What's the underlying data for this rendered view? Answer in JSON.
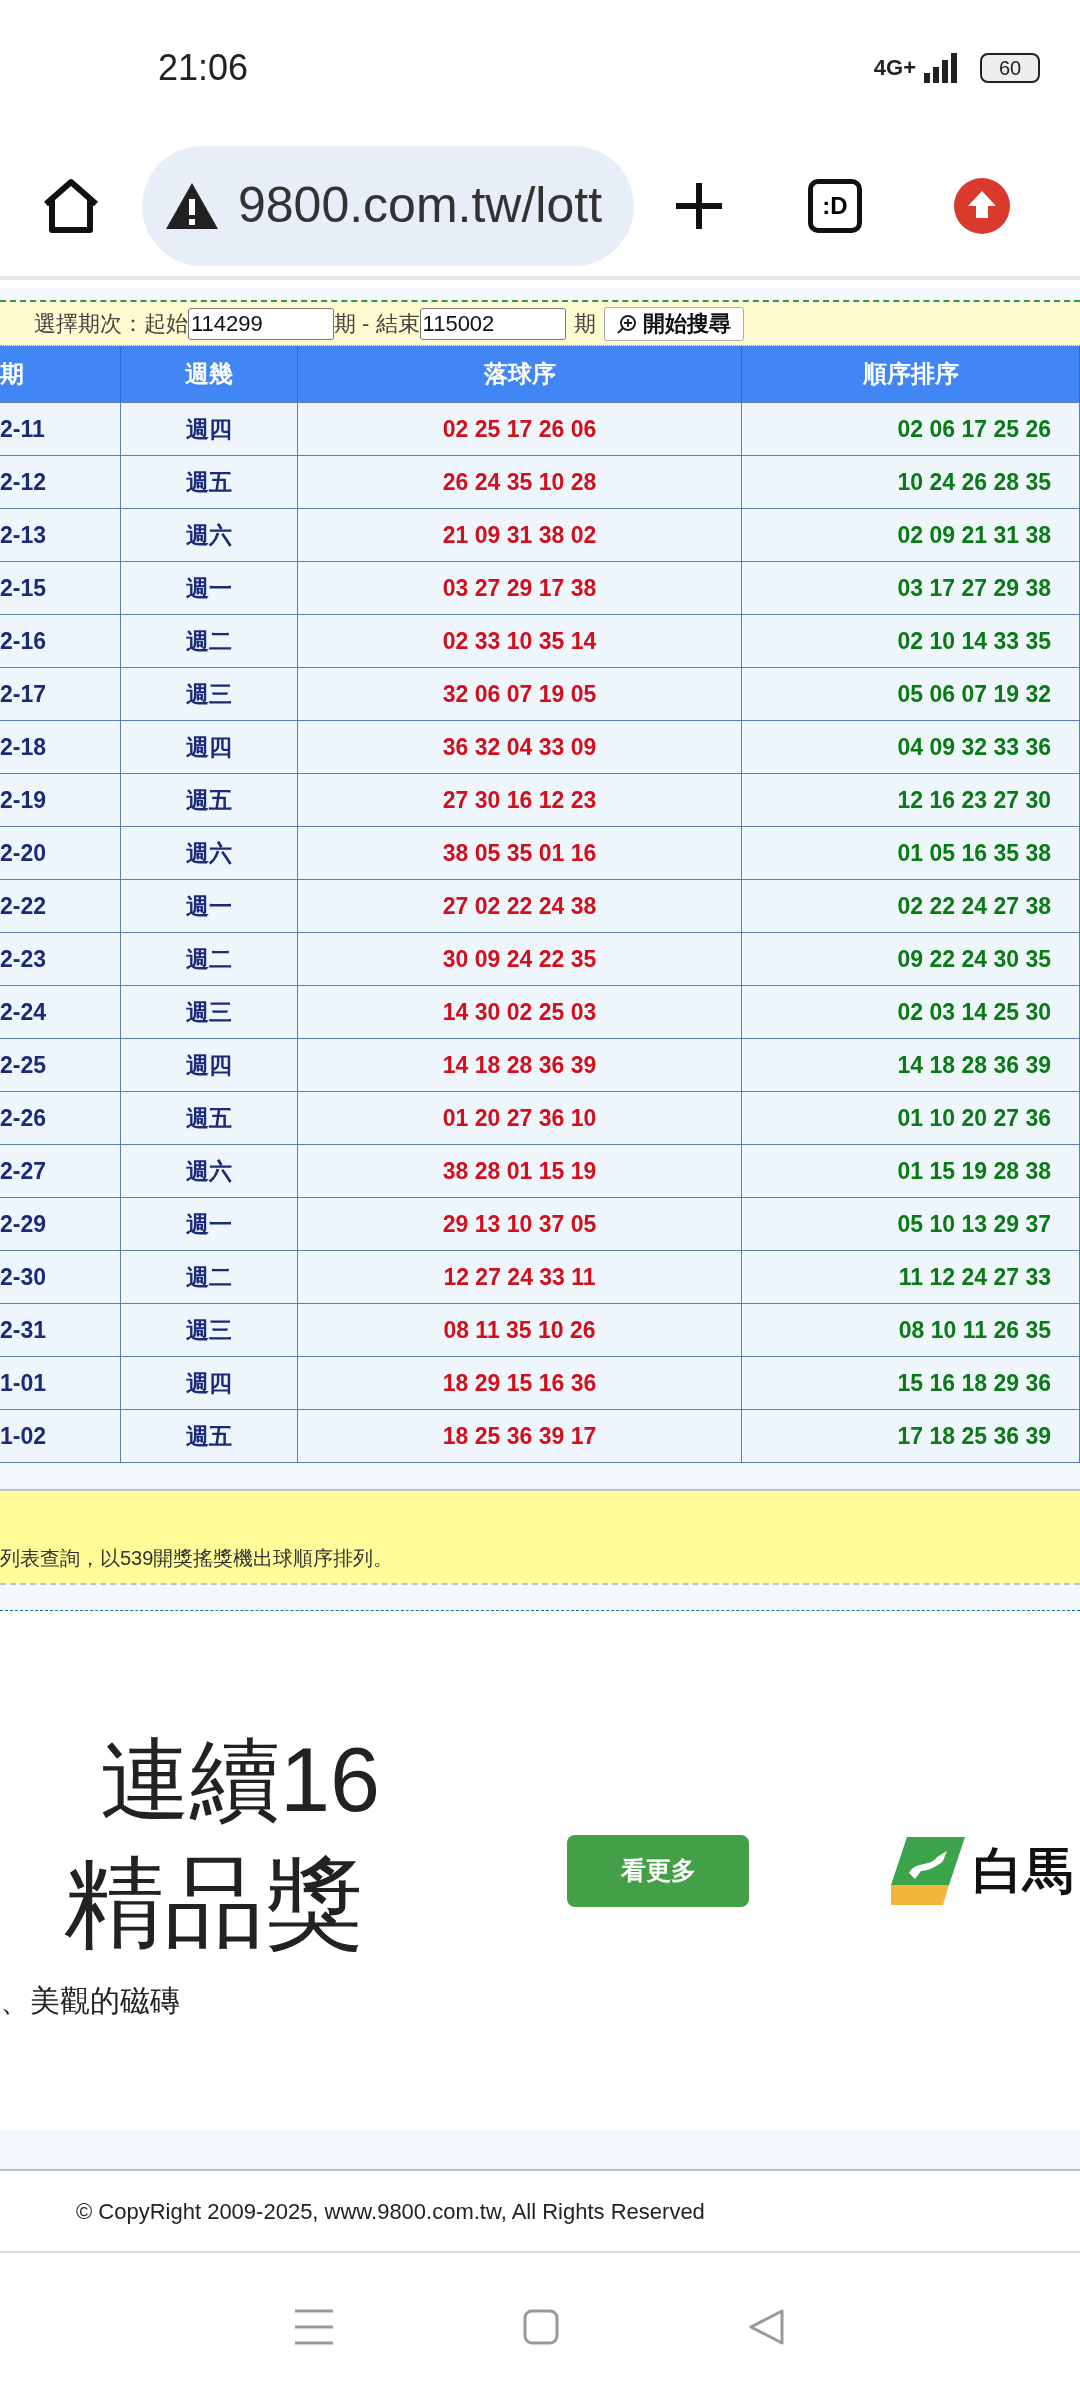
{
  "status_bar": {
    "time": "21:06",
    "network": "4G+",
    "battery": "60"
  },
  "browser": {
    "url": "9800.com.tw/lott",
    "tab_button": ":D"
  },
  "search": {
    "label": "選擇期次：起始",
    "start": "114299",
    "mid": "期 - 結束",
    "end": "115002",
    "suffix": "期",
    "button": "開始搜尋"
  },
  "table": {
    "columns": [
      "期",
      "週幾",
      "落球序",
      "順序排序"
    ],
    "rows": [
      [
        "2-11",
        "週四",
        "02 25 17 26 06",
        "02 06 17 25 26"
      ],
      [
        "2-12",
        "週五",
        "26 24 35 10 28",
        "10 24 26 28 35"
      ],
      [
        "2-13",
        "週六",
        "21 09 31 38 02",
        "02 09 21 31 38"
      ],
      [
        "2-15",
        "週一",
        "03 27 29 17 38",
        "03 17 27 29 38"
      ],
      [
        "2-16",
        "週二",
        "02 33 10 35 14",
        "02 10 14 33 35"
      ],
      [
        "2-17",
        "週三",
        "32 06 07 19 05",
        "05 06 07 19 32"
      ],
      [
        "2-18",
        "週四",
        "36 32 04 33 09",
        "04 09 32 33 36"
      ],
      [
        "2-19",
        "週五",
        "27 30 16 12 23",
        "12 16 23 27 30"
      ],
      [
        "2-20",
        "週六",
        "38 05 35 01 16",
        "01 05 16 35 38"
      ],
      [
        "2-22",
        "週一",
        "27 02 22 24 38",
        "02 22 24 27 38"
      ],
      [
        "2-23",
        "週二",
        "30 09 24 22 35",
        "09 22 24 30 35"
      ],
      [
        "2-24",
        "週三",
        "14 30 02 25 03",
        "02 03 14 25 30"
      ],
      [
        "2-25",
        "週四",
        "14 18 28 36 39",
        "14 18 28 36 39"
      ],
      [
        "2-26",
        "週五",
        "01 20 27 36 10",
        "01 10 20 27 36"
      ],
      [
        "2-27",
        "週六",
        "38 28 01 15 19",
        "01 15 19 28 38"
      ],
      [
        "2-29",
        "週一",
        "29 13 10 37 05",
        "05 10 13 29 37"
      ],
      [
        "2-30",
        "週二",
        "12 27 24 33 11",
        "11 12 24 27 33"
      ],
      [
        "2-31",
        "週三",
        "08 11 35 10 26",
        "08 10 11 26 35"
      ],
      [
        "1-01",
        "週四",
        "18 29 15 16 36",
        "15 16 18 29 36"
      ],
      [
        "1-02",
        "週五",
        "18 25 36 39 17",
        "17 18 25 36 39"
      ]
    ]
  },
  "note": "列表查詢，以539開獎搖獎機出球順序排列。",
  "ad": {
    "headline": [
      "連續16",
      "精品獎"
    ],
    "subline": "、美觀的磁磚",
    "button": "看更多",
    "brand": "白馬"
  },
  "footer": {
    "copyright": "© CopyRight 2009-2025, www.9800.com.tw, All Rights Reserved"
  }
}
